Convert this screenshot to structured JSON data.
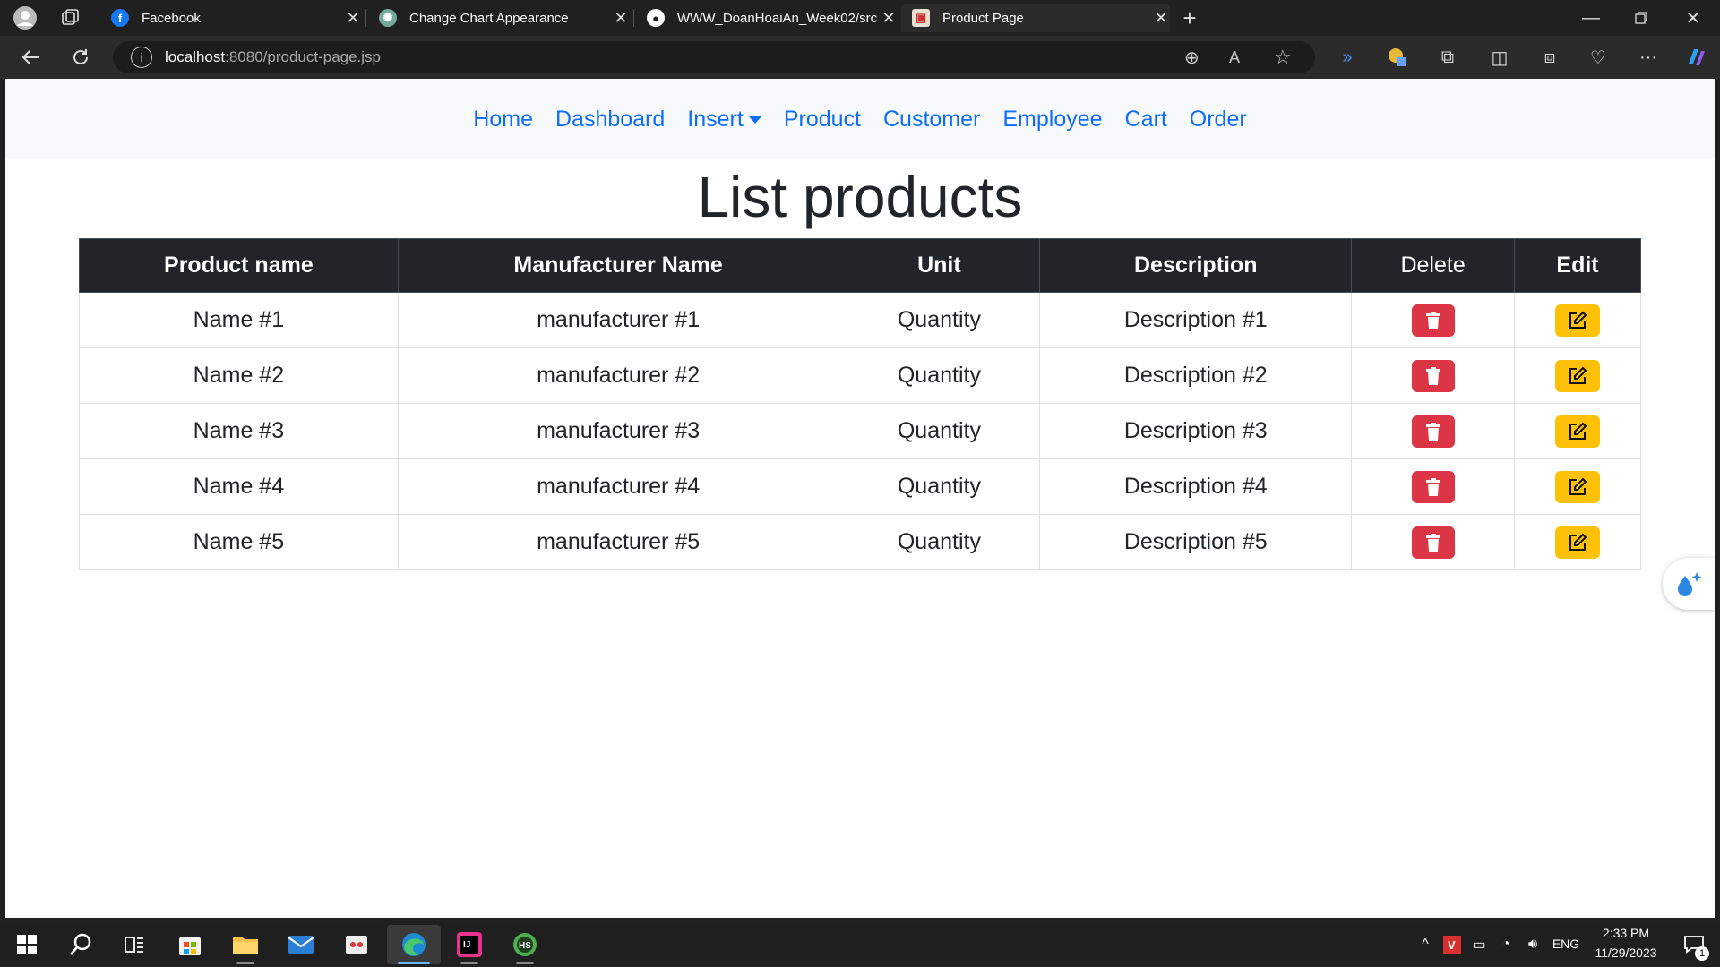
{
  "browser": {
    "tabs": [
      {
        "title": "Facebook"
      },
      {
        "title": "Change Chart Appearance"
      },
      {
        "title": "WWW_DoanHoaiAn_Week02/src"
      },
      {
        "title": "Product Page"
      }
    ],
    "url_host": "localhost",
    "url_path": ":8080/product-page.jsp"
  },
  "nav": {
    "home": "Home",
    "dashboard": "Dashboard",
    "insert": "Insert",
    "product": "Product",
    "customer": "Customer",
    "employee": "Employee",
    "cart": "Cart",
    "order": "Order"
  },
  "page": {
    "title": "List products"
  },
  "table": {
    "headers": [
      "Product name",
      "Manufacturer Name",
      "Unit",
      "Description",
      "Delete",
      "Edit"
    ],
    "rows": [
      [
        "Name #1",
        "manufacturer #1",
        "Quantity",
        "Description #1"
      ],
      [
        "Name #2",
        "manufacturer #2",
        "Quantity",
        "Description #2"
      ],
      [
        "Name #3",
        "manufacturer #3",
        "Quantity",
        "Description #3"
      ],
      [
        "Name #4",
        "manufacturer #4",
        "Quantity",
        "Description #4"
      ],
      [
        "Name #5",
        "manufacturer #5",
        "Quantity",
        "Description #5"
      ]
    ]
  },
  "taskbar": {
    "language": "ENG",
    "time": "2:33 PM",
    "date": "11/29/2023",
    "notification_count": "1"
  }
}
